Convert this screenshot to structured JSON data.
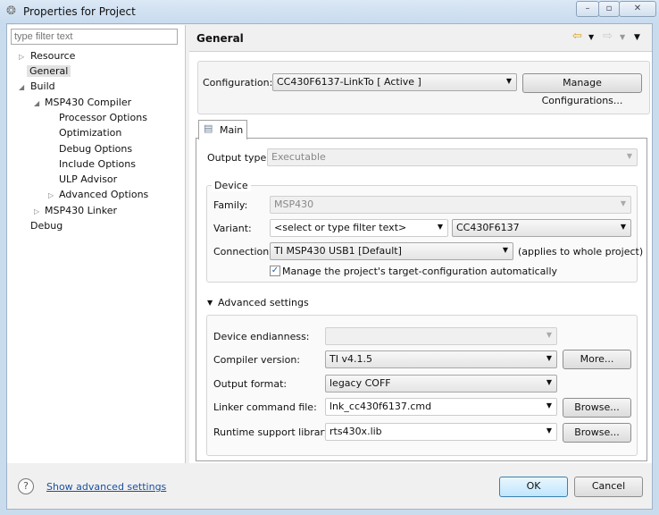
{
  "window": {
    "title": "Properties for Project",
    "controls": [
      "minimize",
      "maximize",
      "close"
    ]
  },
  "filter": {
    "placeholder": "type filter text"
  },
  "tree": [
    {
      "label": "Resource"
    },
    {
      "label": "General",
      "selected": true
    },
    {
      "label": "Build"
    },
    {
      "label": "MSP430 Compiler"
    },
    {
      "label": "Processor Options"
    },
    {
      "label": "Optimization"
    },
    {
      "label": "Debug Options"
    },
    {
      "label": "Include Options"
    },
    {
      "label": "ULP Advisor"
    },
    {
      "label": "Advanced Options"
    },
    {
      "label": "MSP430 Linker"
    },
    {
      "label": "Debug"
    }
  ],
  "page": {
    "title": "General"
  },
  "config": {
    "label": "Configuration:",
    "value": "CC430F6137-LinkTo  [ Active ]",
    "manage": "Manage Configurations..."
  },
  "tab": {
    "label": "Main"
  },
  "main": {
    "output_type_label": "Output type:",
    "output_type": "Executable",
    "device_legend": "Device",
    "family_label": "Family:",
    "family": "MSP430",
    "variant_label": "Variant:",
    "variant_filter": "<select or type filter text>",
    "variant": "CC430F6137",
    "connection_label": "Connection:",
    "connection": "TI MSP430 USB1 [Default]",
    "connection_note": "(applies to whole project)",
    "manage_label": "Manage the project's target-configuration automatically",
    "manage_checked": true
  },
  "advanced": {
    "label": "Advanced settings",
    "endianness_label": "Device endianness:",
    "endianness": "",
    "compiler_label": "Compiler version:",
    "compiler": "TI v4.1.5",
    "more": "More...",
    "format_label": "Output format:",
    "format": "legacy COFF",
    "linker_label": "Linker command file:",
    "linker": "lnk_cc430f6137.cmd",
    "browse1": "Browse...",
    "runtime_label": "Runtime support library:",
    "runtime": "rts430x.lib",
    "browse2": "Browse..."
  },
  "footer": {
    "show_advanced": "Show advanced settings",
    "ok": "OK",
    "cancel": "Cancel"
  }
}
